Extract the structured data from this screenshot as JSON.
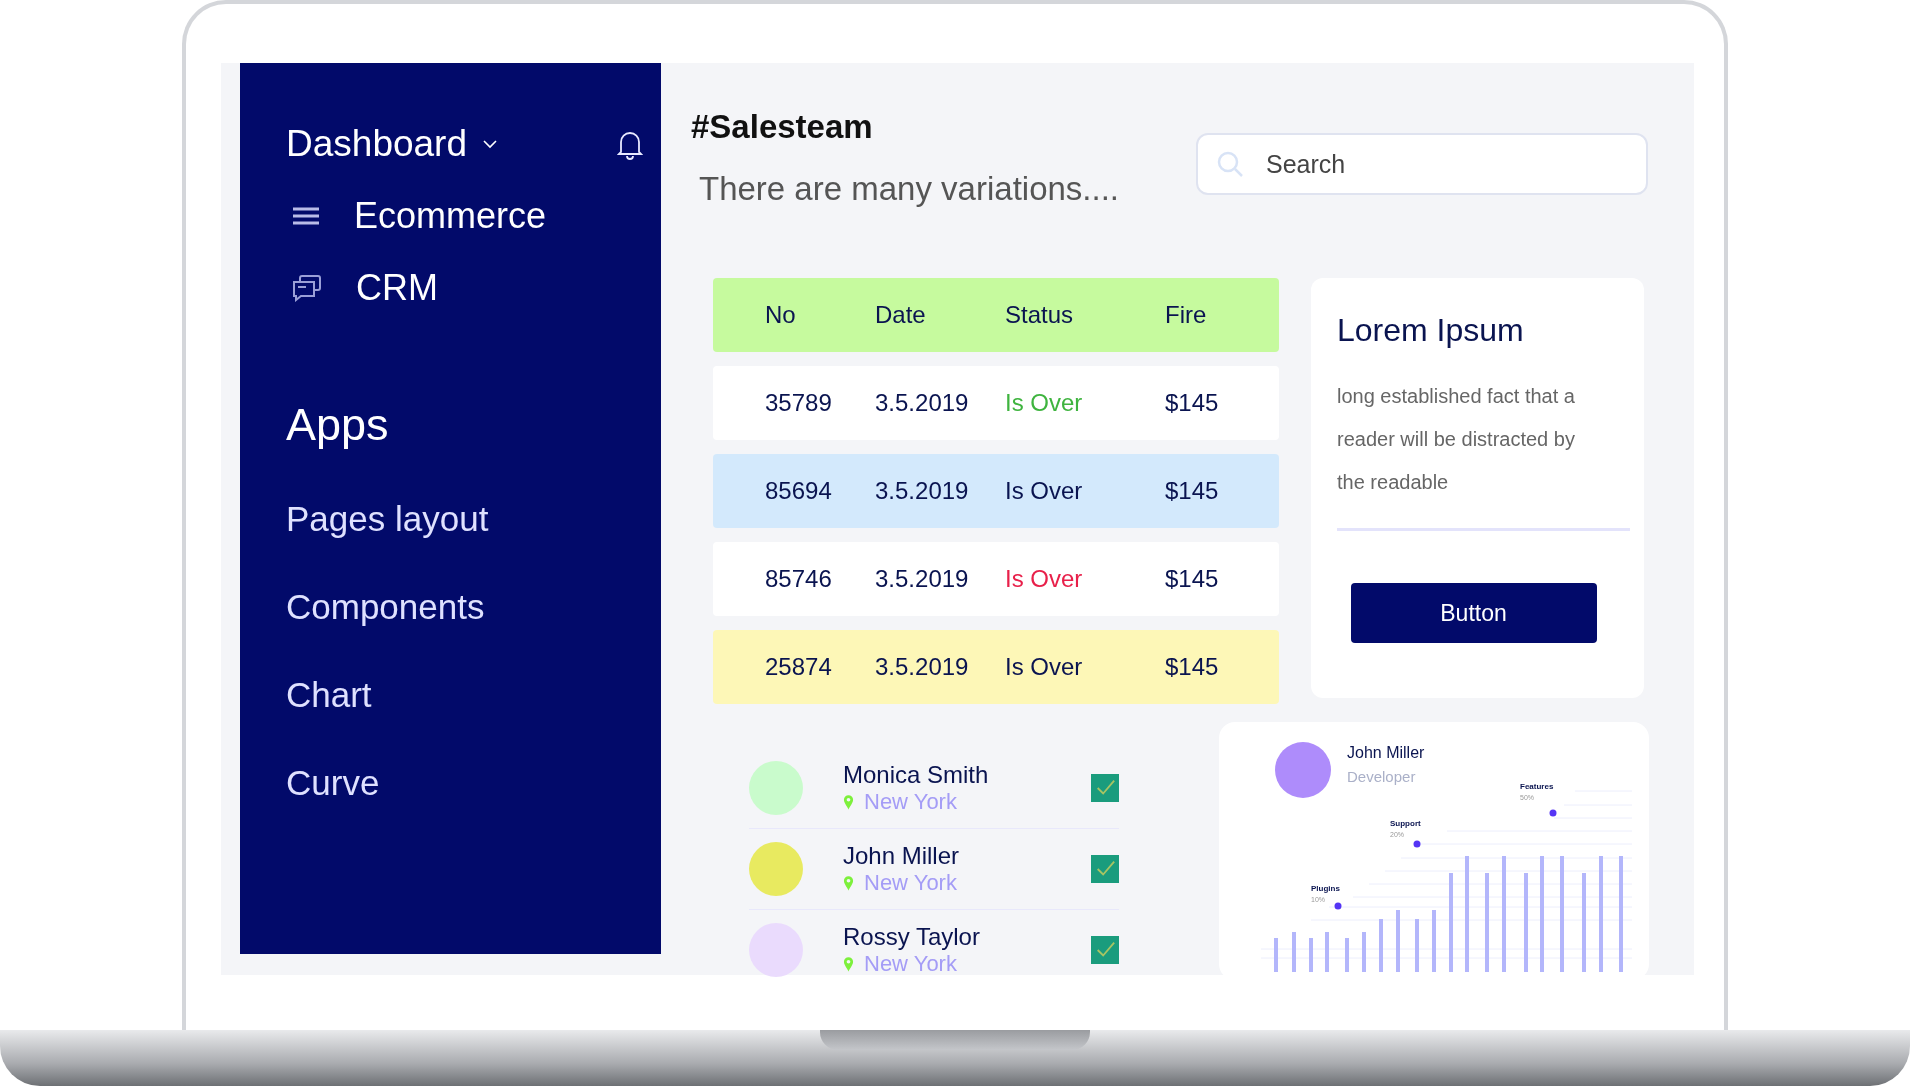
{
  "sidebar": {
    "header": {
      "label": "Dashboard"
    },
    "menu": [
      {
        "label": "Ecommerce",
        "kind": "menu"
      },
      {
        "label": "CRM",
        "kind": "chat"
      }
    ],
    "section_title": "Apps",
    "items": [
      {
        "label": "Pages layout"
      },
      {
        "label": "Components"
      },
      {
        "label": "Chart"
      },
      {
        "label": "Curve"
      }
    ]
  },
  "header": {
    "title": "#Salesteam",
    "subtitle": "There are many variations....",
    "search": {
      "placeholder": "Search"
    }
  },
  "table": {
    "columns": [
      "No",
      "Date",
      "Status",
      "Fire"
    ],
    "rows": [
      {
        "no": "35789",
        "date": "3.5.2019",
        "status": "Is Over",
        "color": "#3fb43f",
        "fire": "$145",
        "kind": "plain"
      },
      {
        "no": "85694",
        "date": "3.5.2019",
        "status": "Is Over",
        "color": "#0a1450",
        "fire": "$145",
        "kind": "accent"
      },
      {
        "no": "85746",
        "date": "3.5.2019",
        "status": "Is Over",
        "color": "#e8204a",
        "fire": "$145",
        "kind": "plain"
      },
      {
        "no": "25874",
        "date": "3.5.2019",
        "status": "Is Over",
        "color": "#0a1450",
        "fire": "$145",
        "kind": "warning"
      }
    ]
  },
  "card": {
    "title": "Lorem Ipsum",
    "text": "long established fact that a reader will be distracted by the readable",
    "button": "Button"
  },
  "people": [
    {
      "name": "Monica Smith",
      "city": "New York",
      "color": "#c9fbcc",
      "checked": true
    },
    {
      "name": "John Miller",
      "city": "New York",
      "color": "#e8ea60",
      "checked": true
    },
    {
      "name": "Rossy Taylor",
      "city": "New York",
      "color": "#eadbfd",
      "checked": true
    }
  ],
  "profile": {
    "name": "John Miller",
    "role": "Developer",
    "color": "#ae8cfb",
    "points": [
      {
        "label": "Plugins",
        "value": "10%"
      },
      {
        "label": "Support",
        "value": "20%"
      },
      {
        "label": "Features",
        "value": "50%"
      }
    ]
  }
}
